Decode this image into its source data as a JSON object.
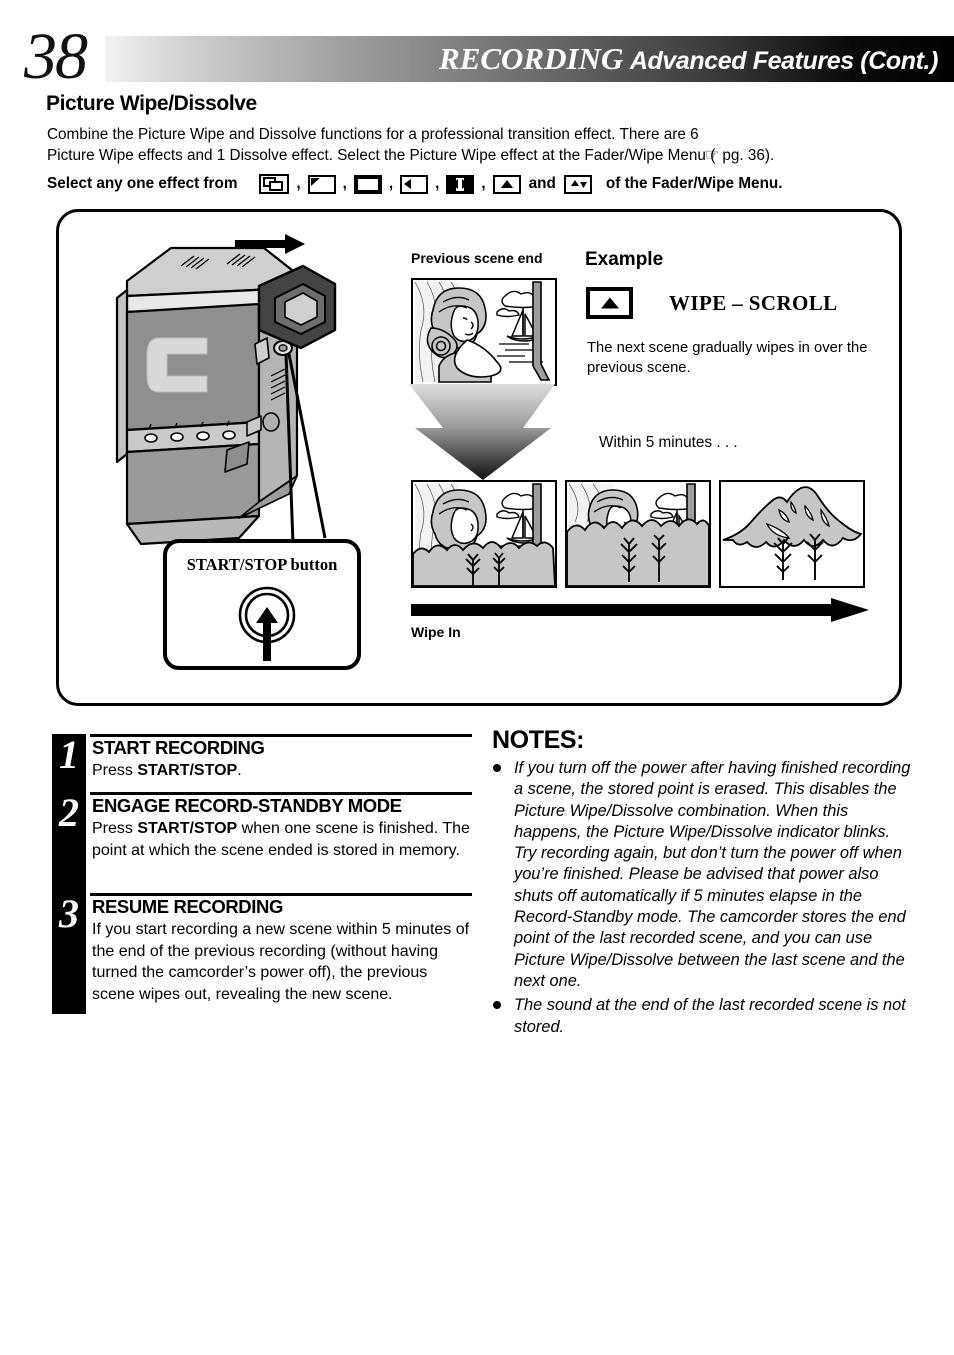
{
  "header": {
    "page_number": "38",
    "title_main": "RECORDING",
    "title_sub": "Advanced Features (Cont.)"
  },
  "section": {
    "title": "Picture Wipe/Dissolve",
    "intro": "Combine the Picture Wipe and Dissolve functions for a professional transition effect. There are 6 Picture Wipe effects and 1 Dissolve effect. Select the Picture Wipe effect at the Fader/Wipe Menu (",
    "page_ref": "pg. 36).",
    "page_ref_icon": "pointing-hand-icon",
    "select_lead": "Select any one effect from",
    "select_conjunction": "and",
    "select_tail": "of the Fader/Wipe Menu.",
    "separator": ",",
    "effect_icons": [
      {
        "name": "dissolve-icon",
        "kind": "dissolve"
      },
      {
        "name": "corner-wipe-icon",
        "kind": "corner"
      },
      {
        "name": "window-wipe-icon",
        "kind": "window"
      },
      {
        "name": "wipe-left-icon",
        "kind": "left"
      },
      {
        "name": "wipe-center-out-icon",
        "kind": "center"
      },
      {
        "name": "wipe-scroll-up-icon",
        "kind": "up"
      },
      {
        "name": "wipe-door-icon",
        "kind": "updown"
      }
    ]
  },
  "illustration": {
    "callout_label": "START/STOP button",
    "label_previous_scene": "Previous scene end",
    "label_example": "Example",
    "wipe_effect_name": "WIPE – SCROLL",
    "wipe_effect_icon": "wipe-scroll-up-icon",
    "wipe_description": "The next scene gradually wipes in over the previous scene.",
    "label_within": "Within 5 minutes . . .",
    "label_wipe_in": "Wipe In",
    "scenes": [
      {
        "name": "scene-woman-sailboat",
        "caption": ""
      },
      {
        "name": "scene-wipe-step-1",
        "caption": ""
      },
      {
        "name": "scene-wipe-step-2",
        "caption": ""
      },
      {
        "name": "scene-mountain",
        "caption": ""
      }
    ]
  },
  "steps": [
    {
      "number": "1",
      "heading": "START RECORDING",
      "body_pre": "Press ",
      "body_bold": "START/STOP",
      "body_post": "."
    },
    {
      "number": "2",
      "heading": "ENGAGE RECORD-STANDBY MODE",
      "body_pre": "Press ",
      "body_bold": "START/STOP",
      "body_post": " when one scene is finished. The point at which the scene ended is stored in memory."
    },
    {
      "number": "3",
      "heading": "RESUME RECORDING",
      "body_pre": "",
      "body_bold": "",
      "body_post": "If you start recording a new scene within 5 minutes of the end of the previous recording (without having turned the camcorder’s power off), the previous scene wipes out, revealing the new scene."
    }
  ],
  "notes": {
    "title": "NOTES:",
    "items": [
      "If you turn off the power after having finished recording a scene, the stored point is erased. This disables the Picture Wipe/Dissolve combination. When this happens, the Picture Wipe/Dissolve indicator blinks. Try recording again, but don’t turn the power off when you’re finished. Please be advised that power also shuts off automatically if 5 minutes elapse in the Record-Standby mode. The camcorder stores the end point of the last recorded scene, and you can use Picture Wipe/Dissolve between the last scene and the next one.",
      "The sound at the end of the last recorded scene is not stored."
    ]
  },
  "colors": {
    "ink": "#000000",
    "paper": "#ffffff",
    "fill_gray": "#b3b3b3",
    "fill_dark": "#808080"
  }
}
